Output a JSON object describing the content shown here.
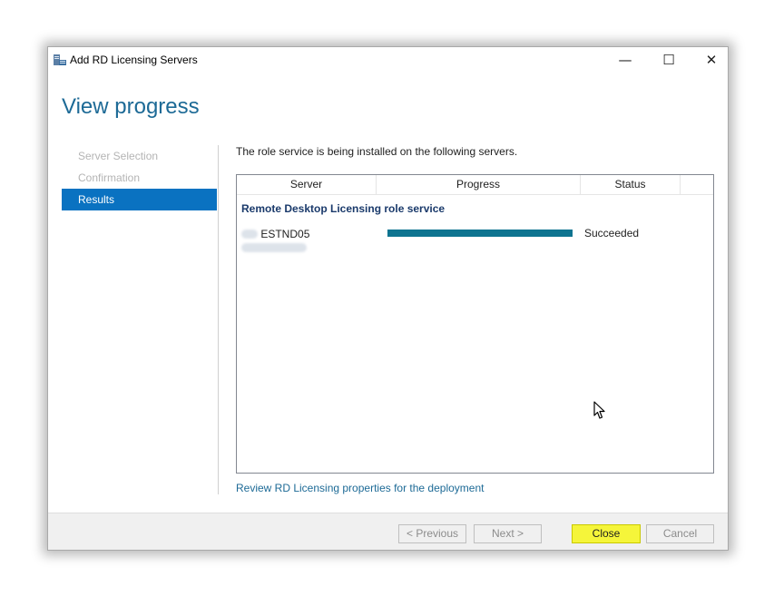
{
  "window": {
    "title": "Add RD Licensing Servers",
    "minimize_glyph": "—",
    "maximize_glyph": "☐",
    "close_glyph": "✕",
    "app_icon": "server-license-icon"
  },
  "heading": "View progress",
  "nav": {
    "items": [
      {
        "label": "Server Selection",
        "state": "disabled"
      },
      {
        "label": "Confirmation",
        "state": "disabled"
      },
      {
        "label": "Results",
        "state": "active"
      }
    ]
  },
  "main": {
    "description": "The role service is being installed on the following servers.",
    "table": {
      "columns": [
        "Server",
        "Progress",
        "Status"
      ],
      "group_label": "Remote Desktop Licensing role service",
      "rows": [
        {
          "server": "ESTND05",
          "progress_percent": 100,
          "status": "Succeeded"
        }
      ]
    },
    "link": "Review RD Licensing properties for the deployment"
  },
  "footer": {
    "previous_label": "< Previous",
    "next_label": "Next >",
    "close_label": "Close",
    "cancel_label": "Cancel"
  },
  "colors": {
    "heading": "#1d6a96",
    "nav_active": "#0a72c1",
    "progress_fill": "#0e7490",
    "close_highlight": "#f5f53a"
  }
}
